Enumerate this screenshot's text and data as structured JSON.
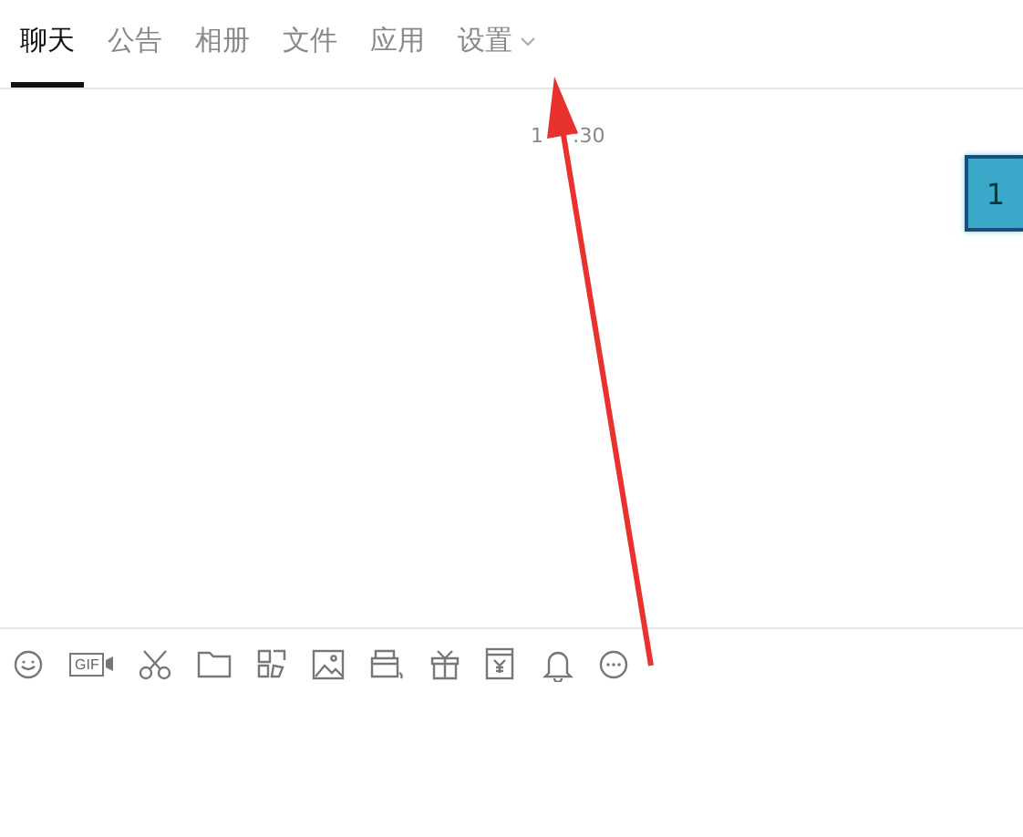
{
  "tabs": [
    {
      "label": "聊天",
      "selected": true
    },
    {
      "label": "公告",
      "selected": false
    },
    {
      "label": "相册",
      "selected": false
    },
    {
      "label": "文件",
      "selected": false
    },
    {
      "label": "应用",
      "selected": false
    },
    {
      "label": "设置",
      "selected": false,
      "dropdown": true
    }
  ],
  "messages": {
    "time_parts": [
      "1",
      ":30"
    ],
    "sticker": {
      "label": "1"
    }
  },
  "toolbar": [
    {
      "kind": "emoji"
    },
    {
      "kind": "gif",
      "label": "GIF"
    },
    {
      "kind": "scissors"
    },
    {
      "kind": "folder"
    },
    {
      "kind": "doodle"
    },
    {
      "kind": "image"
    },
    {
      "kind": "bag"
    },
    {
      "kind": "gift"
    },
    {
      "kind": "wallet"
    },
    {
      "kind": "bell"
    },
    {
      "kind": "more"
    }
  ]
}
